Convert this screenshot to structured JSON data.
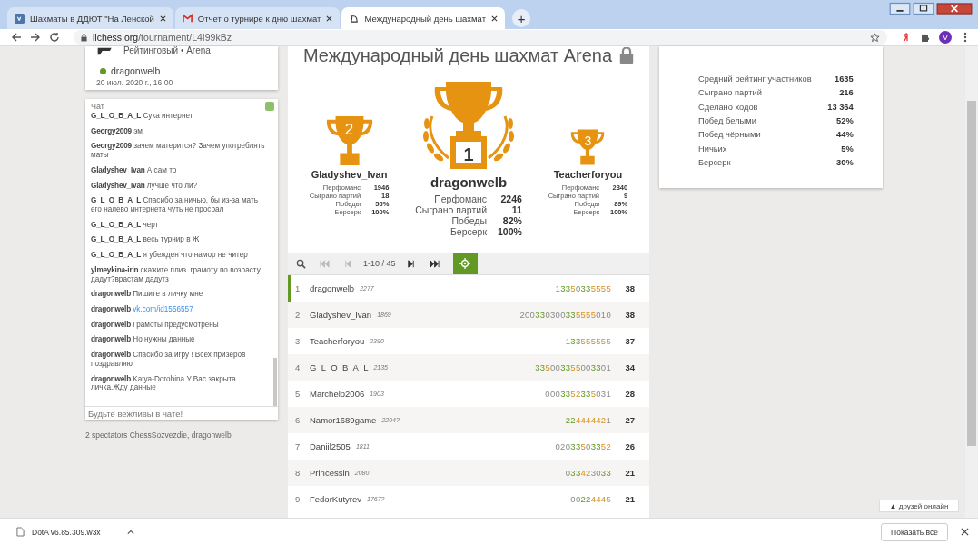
{
  "browser": {
    "tabs": [
      {
        "title": "Шахматы в ДДЮТ \"На Ленской",
        "selected": false
      },
      {
        "title": "Отчет о турнире к дню шахмат",
        "selected": false
      },
      {
        "title": "Международный день шахмат",
        "selected": true
      }
    ],
    "new_tab": "+",
    "url_host": "lichess.org",
    "url_path": "/tournament/L4I99kBz",
    "avatar": "V"
  },
  "info_card": {
    "subtitle": "Рейтинговый • Arena",
    "creator": "dragonwelb",
    "date": "20 июл. 2020 г., 16:00"
  },
  "chat": {
    "title": "Чат",
    "on": true,
    "messages": [
      {
        "user": "G_L_O_B_A_L",
        "text": "Сука интернет",
        "kind": "text"
      },
      {
        "user": "Georgy2009",
        "text": "эм",
        "kind": "text"
      },
      {
        "user": "Georgy2009",
        "text": "зачем матерится? Зачем употреблять маты",
        "kind": "text"
      },
      {
        "user": "Gladyshev_Ivan",
        "text": "А сам то",
        "kind": "text"
      },
      {
        "user": "Gladyshev_Ivan",
        "text": "лучше что ли?",
        "kind": "text"
      },
      {
        "user": "G_L_O_B_A_L",
        "text": "Спасибо за ничью, бы из-за мать его налево интернета чуть не просрал",
        "kind": "text"
      },
      {
        "user": "G_L_O_B_A_L",
        "text": "черт",
        "kind": "text"
      },
      {
        "user": "G_L_O_B_A_L",
        "text": "весь турнир в Ж",
        "kind": "text"
      },
      {
        "user": "G_L_O_B_A_L",
        "text": "я убежден что намор не читер",
        "kind": "text"
      },
      {
        "user": "ylmeykina-irin",
        "text": "скажите плиз. грамоту по возрасту дадут?врастам дадутз",
        "kind": "text"
      },
      {
        "user": "dragonwelb",
        "text": "Пишите в личку мне",
        "kind": "text"
      },
      {
        "user": "dragonwelb",
        "text": "vk.com/id1556557",
        "kind": "link"
      },
      {
        "user": "dragonwelb",
        "text": "Грамоты предусмотрены",
        "kind": "text"
      },
      {
        "user": "dragonwelb",
        "text": "Но нужны данные",
        "kind": "text"
      },
      {
        "user": "dragonwelb",
        "text": "Спасибо за игру ! Всех призёров поздравляю",
        "kind": "text"
      },
      {
        "user": "dragonwelb",
        "text": "Katya-Dorohina У Вас закрыта личка.Жду данные",
        "kind": "text"
      }
    ],
    "placeholder": "Будьте вежливы в чате!"
  },
  "spectators": "2 spectators ChessSozvezdie, dragonwelb",
  "title": "Международный день шахмат Arena",
  "podium": [
    {
      "place": "2",
      "name": "Gladyshev_Ivan",
      "stats": [
        {
          "label": "Перфоманс",
          "value": "1946"
        },
        {
          "label": "Сыграно партий",
          "value": "18"
        },
        {
          "label": "Победы",
          "value": "56%"
        },
        {
          "label": "Берсерк",
          "value": "100%"
        }
      ]
    },
    {
      "place": "1",
      "name": "dragonwelb",
      "stats": [
        {
          "label": "Перфоманс",
          "value": "2246"
        },
        {
          "label": "Сыграно партий",
          "value": "11"
        },
        {
          "label": "Победы",
          "value": "82%"
        },
        {
          "label": "Берсерк",
          "value": "100%"
        }
      ]
    },
    {
      "place": "3",
      "name": "Teacherforyou",
      "stats": [
        {
          "label": "Перфоманс",
          "value": "2340"
        },
        {
          "label": "Сыграно партий",
          "value": "9"
        },
        {
          "label": "Победы",
          "value": "89%"
        },
        {
          "label": "Берсерк",
          "value": "100%"
        }
      ]
    }
  ],
  "pager": {
    "first_disabled": true,
    "prev_disabled": true,
    "next_disabled": false,
    "last_disabled": false,
    "range": "1-10 / 45",
    "focus_on": true
  },
  "standings": [
    {
      "rank": "1",
      "name": "dragonwelb",
      "rating": "2277",
      "score": "38",
      "selected": true,
      "sheet": [
        {
          "t": "1",
          "kind": "plain"
        },
        {
          "t": "33",
          "kind": "win"
        },
        {
          "t": "5",
          "kind": "streak"
        },
        {
          "t": "0",
          "kind": "plain"
        },
        {
          "t": "33",
          "kind": "win"
        },
        {
          "t": "5555",
          "kind": "streak"
        }
      ]
    },
    {
      "rank": "2",
      "name": "Gladyshev_Ivan",
      "rating": "1869",
      "score": "38",
      "selected": false,
      "sheet": [
        {
          "t": "200",
          "kind": "plain"
        },
        {
          "t": "33",
          "kind": "win"
        },
        {
          "t": "0300",
          "kind": "plain"
        },
        {
          "t": "33",
          "kind": "win"
        },
        {
          "t": "5555",
          "kind": "streak"
        },
        {
          "t": "010",
          "kind": "plain"
        }
      ]
    },
    {
      "rank": "3",
      "name": "Teacherforyou",
      "rating": "2390",
      "score": "37",
      "selected": false,
      "sheet": [
        {
          "t": "1",
          "kind": "plain"
        },
        {
          "t": "33",
          "kind": "win"
        },
        {
          "t": "555555",
          "kind": "streak"
        }
      ]
    },
    {
      "rank": "4",
      "name": "G_L_O_B_A_L",
      "rating": "2135",
      "score": "34",
      "selected": false,
      "sheet": [
        {
          "t": "33",
          "kind": "win"
        },
        {
          "t": "5",
          "kind": "streak"
        },
        {
          "t": "00",
          "kind": "plain"
        },
        {
          "t": "33",
          "kind": "win"
        },
        {
          "t": "55",
          "kind": "streak"
        },
        {
          "t": "00",
          "kind": "plain"
        },
        {
          "t": "33",
          "kind": "win"
        },
        {
          "t": "01",
          "kind": "plain"
        }
      ]
    },
    {
      "rank": "5",
      "name": "Marchelo2006",
      "rating": "1903",
      "score": "28",
      "selected": false,
      "sheet": [
        {
          "t": "000",
          "kind": "plain"
        },
        {
          "t": "33",
          "kind": "win"
        },
        {
          "t": "52",
          "kind": "streak"
        },
        {
          "t": "33",
          "kind": "win"
        },
        {
          "t": "5",
          "kind": "streak"
        },
        {
          "t": "031",
          "kind": "plain"
        }
      ]
    },
    {
      "rank": "6",
      "name": "Namor1689game",
      "rating": "2204?",
      "score": "27",
      "selected": false,
      "sheet": [
        {
          "t": "22",
          "kind": "win"
        },
        {
          "t": "444442",
          "kind": "streak"
        },
        {
          "t": "1",
          "kind": "plain"
        }
      ]
    },
    {
      "rank": "7",
      "name": "Daniil2505",
      "rating": "1811",
      "score": "26",
      "selected": false,
      "sheet": [
        {
          "t": "020",
          "kind": "plain"
        },
        {
          "t": "33",
          "kind": "win"
        },
        {
          "t": "5",
          "kind": "streak"
        },
        {
          "t": "0",
          "kind": "plain"
        },
        {
          "t": "33",
          "kind": "win"
        },
        {
          "t": "52",
          "kind": "streak"
        }
      ]
    },
    {
      "rank": "8",
      "name": "Princessin",
      "rating": "2080",
      "score": "21",
      "selected": false,
      "sheet": [
        {
          "t": "0",
          "kind": "plain"
        },
        {
          "t": "33",
          "kind": "win"
        },
        {
          "t": "42",
          "kind": "streak"
        },
        {
          "t": "30",
          "kind": "plain"
        },
        {
          "t": "33",
          "kind": "win"
        }
      ]
    },
    {
      "rank": "9",
      "name": "FedorKutyrev",
      "rating": "1767?",
      "score": "21",
      "selected": false,
      "sheet": [
        {
          "t": "00",
          "kind": "plain"
        },
        {
          "t": "22",
          "kind": "win"
        },
        {
          "t": "4445",
          "kind": "streak"
        }
      ]
    }
  ],
  "summary": [
    {
      "label": "Средний рейтинг участников",
      "value": "1635"
    },
    {
      "label": "Сыграно партий",
      "value": "216"
    },
    {
      "label": "Сделано ходов",
      "value": "13 364"
    },
    {
      "label": "Побед белыми",
      "value": "52%"
    },
    {
      "label": "Побед чёрными",
      "value": "44%"
    },
    {
      "label": "Ничьих",
      "value": "5%"
    },
    {
      "label": "Берсерк",
      "value": "30%"
    }
  ],
  "friends": "▲ друзей онлайн",
  "download_bar": {
    "file": "DotA v6.85.309.w3x",
    "show_all": "Показать все"
  }
}
